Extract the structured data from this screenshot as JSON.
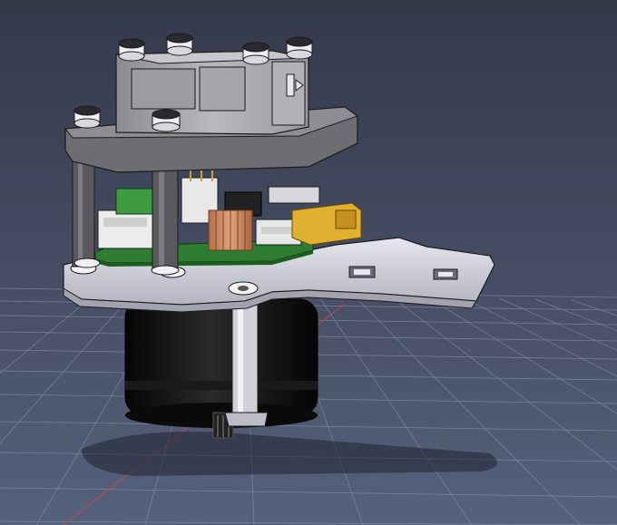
{
  "scene": {
    "background_top": "#34394a",
    "background_bottom": "#55607a",
    "grid_color": "#9aa6c2",
    "axis_x_color": "#c04a4a",
    "shadow_color": "#1f2330"
  },
  "model": {
    "plastic_light": "#d8d8e0",
    "plastic_dark": "#8f8f94",
    "plastic_mid": "#a9a9ae",
    "motor_color": "#111111",
    "pcb_color": "#2e7d32",
    "heatsink_color": "#c98a5a",
    "connector_yellow": "#e0b030",
    "outline": "#1a1a1a"
  }
}
